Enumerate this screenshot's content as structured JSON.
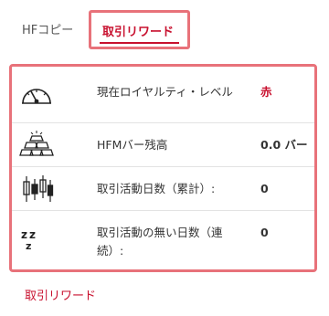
{
  "tabs": [
    {
      "label": "HFコピー",
      "active": false
    },
    {
      "label": "取引リワード",
      "active": true
    }
  ],
  "rows": [
    {
      "icon": "gauge-icon",
      "label": "現在ロイヤルティ・レベル",
      "value": "赤",
      "value_color": "#c8102e"
    },
    {
      "icon": "gold-bars-icon",
      "label": "HFMバー残高",
      "value": "0.0 バー"
    },
    {
      "icon": "candlestick-icon",
      "label": "取引活動日数（累計）:",
      "value": "0"
    },
    {
      "icon": "sleep-zzz-icon",
      "label": "取引活動の無い日数（連続）:",
      "value": "0"
    }
  ],
  "footer": {
    "link_label": "取引リワード"
  },
  "colors": {
    "accent": "#c8102e",
    "highlight_border": "#e8727a"
  }
}
